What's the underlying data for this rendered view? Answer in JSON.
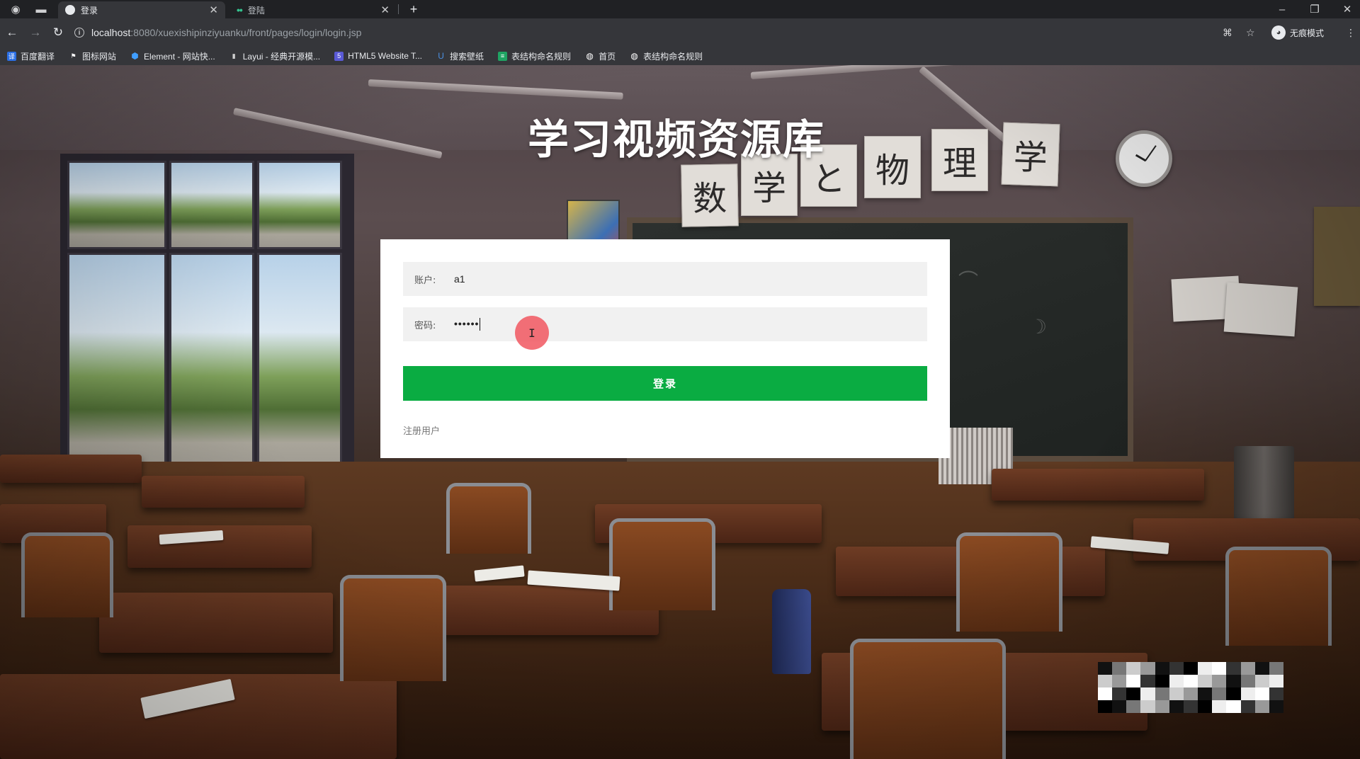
{
  "browser": {
    "tabs": [
      {
        "title": "登录",
        "active": true
      },
      {
        "title": "登陆",
        "active": false
      }
    ],
    "url_host": "localhost",
    "url_rest": ":8080/xuexishipinziyuanku/front/pages/login/login.jsp",
    "profile_label": "无痕模式",
    "bookmarks": [
      {
        "label": "百度翻译",
        "icon": "baidu-translate-icon",
        "color": "#2b6fe5"
      },
      {
        "label": "图标网站",
        "icon": "flag-icon",
        "color": "#e8eaed"
      },
      {
        "label": "Element - 网站快...",
        "icon": "element-icon",
        "color": "#409eff"
      },
      {
        "label": "Layui - 经典开源模...",
        "icon": "layui-icon",
        "color": "#d0d0d0"
      },
      {
        "label": "HTML5 Website T...",
        "icon": "html5-icon",
        "color": "#5a5ad6"
      },
      {
        "label": "搜索壁纸",
        "icon": "wallpaper-icon",
        "color": "#4a8fe0"
      },
      {
        "label": "表结构命名规则",
        "icon": "sheet-icon",
        "color": "#1fa463"
      },
      {
        "label": "首页",
        "icon": "globe-icon",
        "color": "#e8eaed"
      },
      {
        "label": "表结构命名规则",
        "icon": "globe-icon",
        "color": "#e8eaed"
      }
    ]
  },
  "page": {
    "site_title": "学习视频资源库",
    "banner_cards": [
      "数",
      "学",
      "と",
      "物",
      "理",
      "学"
    ],
    "login": {
      "account_label": "账户:",
      "account_value": "a1",
      "password_label": "密码:",
      "password_value": "••••••",
      "submit_label": "登录",
      "register_label": "注册用户"
    },
    "cursor_glyph": "I"
  },
  "colors": {
    "primary_button": "#0aac42",
    "card_bg": "#ffffff",
    "field_bg": "#f1f1f1",
    "cursor_highlight": "#f0505a"
  }
}
